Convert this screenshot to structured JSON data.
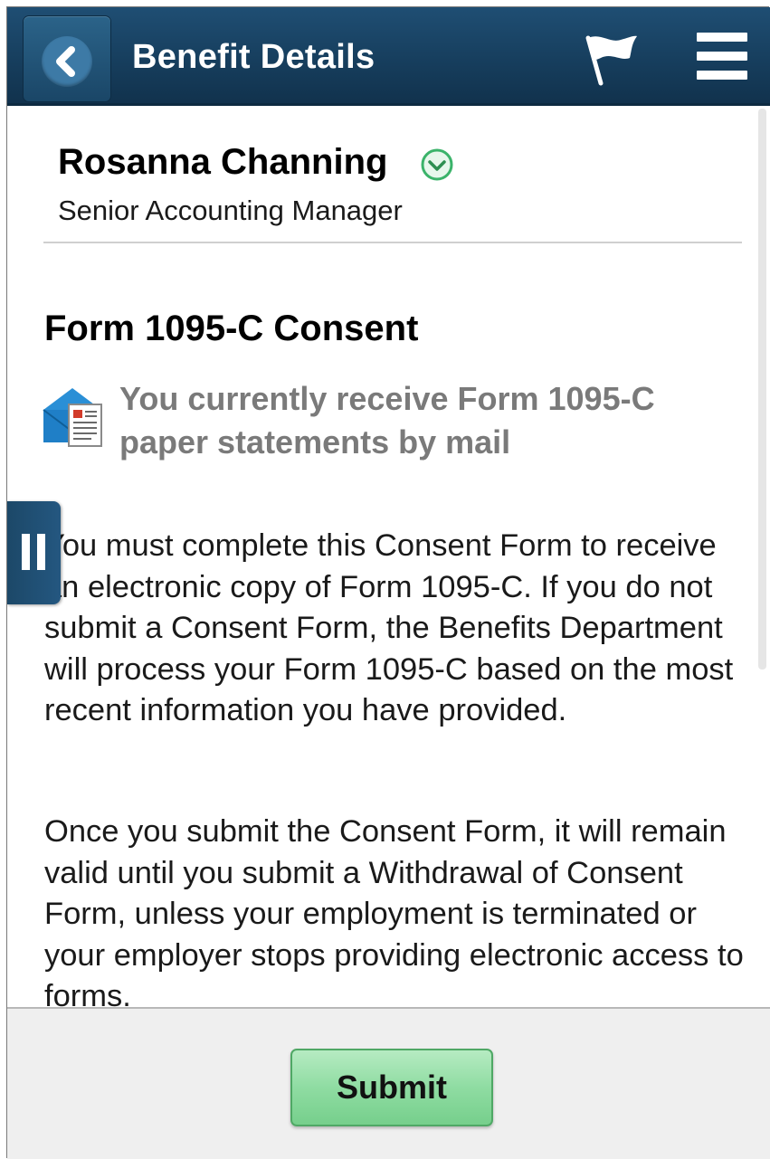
{
  "header": {
    "title": "Benefit Details",
    "back_icon": "chevron-left-icon",
    "flag_icon": "flag-icon",
    "menu_icon": "hamburger-menu-icon"
  },
  "person": {
    "name": "Rosanna Channing",
    "title": "Senior Accounting Manager",
    "toggle_icon": "chevron-down-circle-icon"
  },
  "section": {
    "title": "Form 1095-C Consent",
    "status_icon": "mail-document-icon",
    "status_text": "You currently receive Form 1095-C paper statements by mail"
  },
  "paragraphs": [
    "You must complete this Consent Form to receive an electronic copy of Form 1095-C. If you do not submit a Consent Form, the Benefits Department will process your Form 1095-C based on the most recent information you have provided.",
    "Once you submit the Consent Form, it will remain valid until you submit a Withdrawal of Consent Form, unless your employment is terminated or your employer stops providing electronic access to forms."
  ],
  "side_tab": {
    "icon": "pause-icon"
  },
  "footer": {
    "submit_label": "Submit"
  },
  "colors": {
    "header_bg": "#1f4e73",
    "submit_bg": "#8fdca2",
    "status_text": "#7a7a7a",
    "toggle_green": "#3bb36a"
  }
}
